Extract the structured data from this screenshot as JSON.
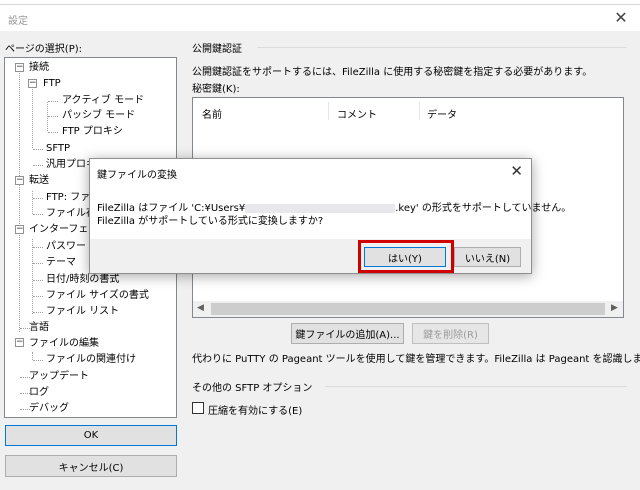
{
  "window": {
    "title": "設定",
    "close_glyph": "✕"
  },
  "left_panel": {
    "label": "ページの選択(P):",
    "tree": [
      {
        "label": "接続",
        "expander": "−"
      },
      {
        "label": "FTP",
        "expander": "−"
      },
      {
        "label": "アクティブ モード"
      },
      {
        "label": "パッシブ モード"
      },
      {
        "label": "FTP プロキシ"
      },
      {
        "label": "SFTP"
      },
      {
        "label": "汎用プロキ"
      },
      {
        "label": "転送",
        "expander": "−"
      },
      {
        "label": "FTP: ファイ"
      },
      {
        "label": "ファイル存"
      },
      {
        "label": "インターフェイス",
        "expander": "−"
      },
      {
        "label": "パスワード"
      },
      {
        "label": "テーマ"
      },
      {
        "label": "日付/時刻の書式"
      },
      {
        "label": "ファイル サイズの書式"
      },
      {
        "label": "ファイル リスト"
      },
      {
        "label": "言語"
      },
      {
        "label": "ファイルの編集",
        "expander": "−"
      },
      {
        "label": "ファイルの関連付け"
      },
      {
        "label": "アップデート"
      },
      {
        "label": "ログ"
      },
      {
        "label": "デバッグ"
      }
    ],
    "ok_label": "OK",
    "cancel_label": "キャンセル(C)"
  },
  "pubkey": {
    "group_title": "公開鍵認証",
    "description": "公開鍵認証をサポートするには、FileZilla に使用する秘密鍵を指定する必要があります。",
    "private_key_label": "秘密鍵(K):",
    "columns": [
      "名前",
      "コメント",
      "データ"
    ],
    "add_key_label": "鍵ファイルの追加(A)...",
    "remove_key_label": "鍵を削除(R)",
    "pageant_note": "代わりに PuTTY の Pageant ツールを使用して鍵を管理できます。FileZilla は Pageant を認識します。"
  },
  "sftp_options": {
    "group_title": "その他の SFTP オプション",
    "compression_label": "圧縮を有効にする(E)",
    "compression_checked": false
  },
  "dialog": {
    "title": "鍵ファイルの変換",
    "message_line1_a": "FileZilla はファイル 'C:¥Users¥",
    "message_line1_b": ".key' の形式をサポートしていません。",
    "message_line2": "FileZilla がサポートしている形式に変換しますか?",
    "yes_label": "はい(Y)",
    "no_label": "いいえ(N)",
    "close_glyph": "✕"
  },
  "colors": {
    "highlight_border": "#d00000",
    "primary_button_border": "#0078d7"
  }
}
